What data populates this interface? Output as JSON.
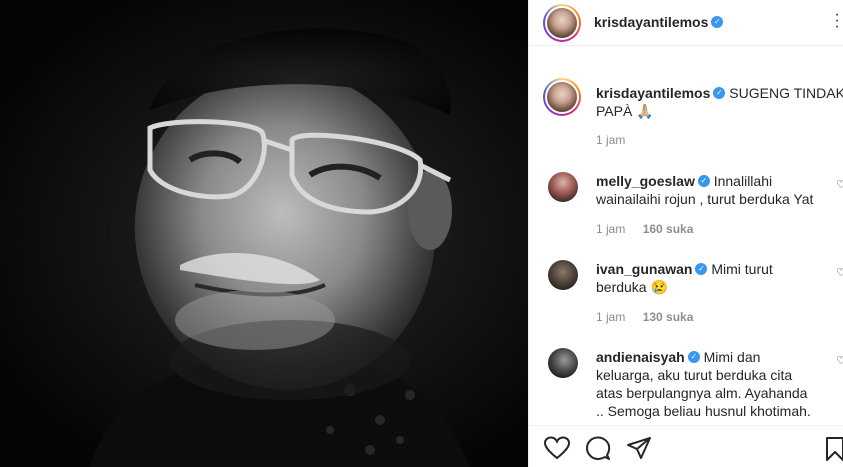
{
  "post": {
    "author": "krisdayantilemos"
  },
  "caption": {
    "username": "krisdayantilemos",
    "text_line1": "SUGENG TINDAK",
    "text_line2": "PAPÀ 🙏🏼",
    "time": "1 jam"
  },
  "comments": [
    {
      "username": "melly_goeslaw",
      "line1": "Innalillahi",
      "line2": "wainailaihi rojun , turut berduka Yat",
      "time": "1 jam",
      "likes": "160 suka"
    },
    {
      "username": "ivan_gunawan",
      "line1": "Mimi turut",
      "line2": "berduka 😢",
      "time": "1 jam",
      "likes": "130 suka"
    },
    {
      "username": "andienaisyah",
      "line1": "Mimi dan",
      "line2": "keluarga, aku turut berduka cita",
      "line3": "atas berpulangnya alm. Ayahanda",
      "line4": ".. Semoga beliau husnul khotimah."
    }
  ],
  "icons": {
    "verified": "verified-badge-icon",
    "more": "more-options-icon",
    "like": "heart-icon",
    "comment": "comment-bubble-icon",
    "share": "paper-plane-icon",
    "save": "bookmark-icon"
  },
  "colors": {
    "verified": "#3897f0",
    "meta_text": "#8e8e8e",
    "primary_text": "#262626"
  }
}
